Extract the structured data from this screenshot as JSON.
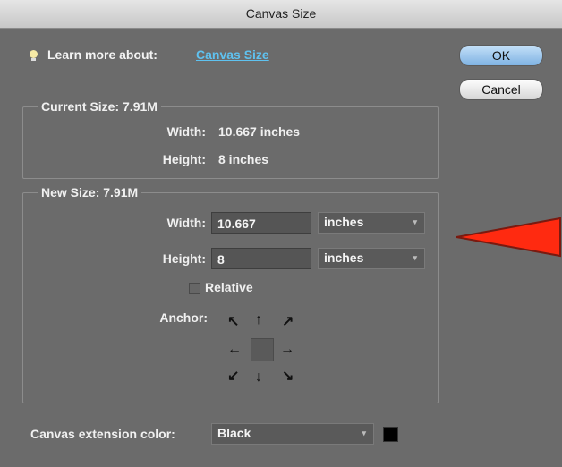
{
  "window": {
    "title": "Canvas Size"
  },
  "learn": {
    "prefix": "Learn more about:",
    "link": "Canvas Size"
  },
  "buttons": {
    "ok": "OK",
    "cancel": "Cancel"
  },
  "current_size": {
    "legend": "Current Size: 7.91M",
    "width_label": "Width:",
    "width_value": "10.667 inches",
    "height_label": "Height:",
    "height_value": "8 inches"
  },
  "new_size": {
    "legend": "New Size: 7.91M",
    "width_label": "Width:",
    "width_value": "10.667",
    "width_unit": "inches",
    "height_label": "Height:",
    "height_value": "8",
    "height_unit": "inches",
    "relative_label": "Relative",
    "relative_checked": false,
    "anchor_label": "Anchor:"
  },
  "extension": {
    "label": "Canvas extension color:",
    "value": "Black",
    "swatch_color": "#000000"
  },
  "icons": {
    "bulb": "lightbulb-icon",
    "annotation": "red-arrow-pointer",
    "anchor_arrows": [
      "arrow-nw",
      "arrow-n",
      "arrow-ne",
      "arrow-w",
      "arrow-e",
      "arrow-sw",
      "arrow-s",
      "arrow-se"
    ]
  },
  "colors": {
    "accent_link": "#5fc2f0",
    "pointer": "#ff2a10",
    "dialog_bg": "#6b6b6b"
  }
}
